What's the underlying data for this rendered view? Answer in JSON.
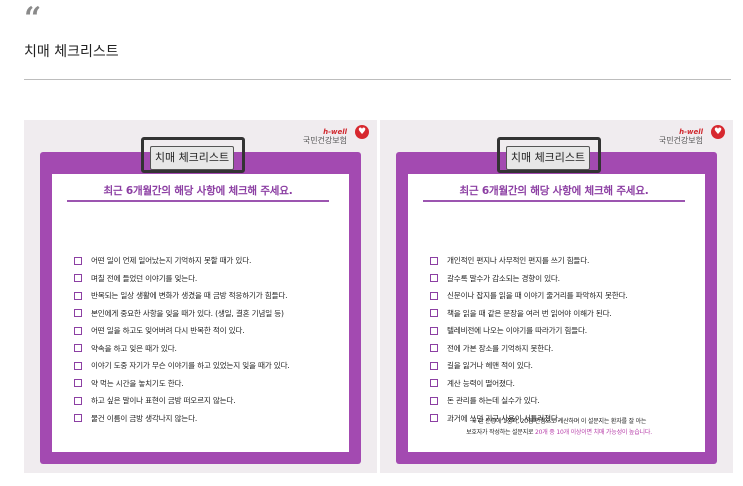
{
  "post": {
    "quote_mark": "“",
    "title": "치매 체크리스트"
  },
  "brand": {
    "tagline": "h-well",
    "name": "국민건강보험"
  },
  "cards": [
    {
      "tag": "치매 체크리스트",
      "heading": "최근 6개월간의 해당 사항에 체크해 주세요.",
      "items": [
        "어떤 일이 언제 일어났는지 기억하지 못할 때가 있다.",
        "며칠 전에 들었던 이야기를 잊는다.",
        "반복되는 일상 생활에 변화가 생겼을 때 금방 적응하기가 힘들다.",
        "본인에게 중요한 사항을 잊을 때가 있다. (생일, 결혼 기념일 등)",
        "어떤 일을 하고도 잊어버려 다시 반복한 적이 있다.",
        "약속을 하고 잊은 때가 있다.",
        "이야기 도중 자기가 무슨 이야기를 하고 있었는지 잊을 때가 있다.",
        "약 먹는 시간을 놓치기도 한다.",
        "하고 싶은 말이나 표현이 금방 떠오르지 않는다.",
        "물건 이름이 금방 생각나지 않는다."
      ]
    },
    {
      "tag": "치매 체크리스트",
      "heading": "최근 6개월간의 해당 사항에 체크해 주세요.",
      "items": [
        "개인적인 편지나 사무적인 편지를 쓰기 힘들다.",
        "갈수록 말수가 감소되는 경향이 있다.",
        "신문이나 잡지를 읽을 때 이야기 줄거리를 파악하지 못한다.",
        "책을 읽을 때 같은 문장을 여러 번 읽어야 이해가 된다.",
        "텔레비전에 나오는 이야기를 따라가기 힘들다.",
        "전에 가본 장소를 기억하지 못한다.",
        "길을 잃거나 헤맨 적이 있다.",
        "계산 능력이 떨어졌다.",
        "돈 관리를 하는데 실수가 있다.",
        "과거에 쓰던 기구 사용이 서툴러졌다."
      ],
      "note": {
        "line1": "※ 한 문항에 1점씩, 20점 만점으로 계산하며 이 설문지는 환자를 잘 아는",
        "line2_prefix": "보호자가 작성하는 설문지로 ",
        "line2_highlight": "20개 중 10개 이상이면 치매 가능성이 높습니다."
      }
    }
  ],
  "colors": {
    "frame": "#a34ab1",
    "accent": "#8c3fa3",
    "brand_red": "#d7282f",
    "card_bg": "#f0ecef"
  }
}
